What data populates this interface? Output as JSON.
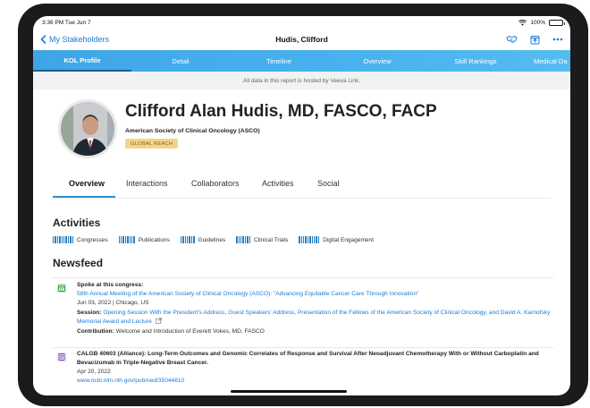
{
  "status": {
    "time_date": "3:36 PM   Tue Jun 7",
    "battery": "100%"
  },
  "nav": {
    "back_label": "My Stakeholders",
    "title": "Hudis, Clifford"
  },
  "tabs": [
    {
      "label": "KOL Profile",
      "active": true
    },
    {
      "label": "Detail"
    },
    {
      "label": "Timeline"
    },
    {
      "label": "Overview"
    },
    {
      "label": "Skill Rankings"
    },
    {
      "label": "Medical Da"
    }
  ],
  "hosted_note": "All data in this report is hosted by Veeva Link.",
  "profile": {
    "name": "Clifford Alan Hudis, MD, FASCO, FACP",
    "organization": "American Society of Clinical Oncology (ASCO)",
    "badge": "GLOBAL REACH"
  },
  "subtabs": [
    "Overview",
    "Interactions",
    "Collaborators",
    "Activities",
    "Social"
  ],
  "activities": {
    "title": "Activities",
    "legend": [
      "Congresses",
      "Publications",
      "Guidelines",
      "Clinical Trials",
      "Digital Engagement"
    ],
    "color": "#2a7fbf"
  },
  "newsfeed": {
    "title": "Newsfeed",
    "items": [
      {
        "icon": "calendar-icon",
        "heading": "Spoke at this congress:",
        "event_link": "58th Annual Meeting of the American Society of Clinical Oncology (ASCO): \"Advancing Equitable Cancer Care Through Innovation\"",
        "date_place": "Jun 03, 2022 | Chicago, US",
        "session_label": "Session:",
        "session_link": "Opening Session With the President's Address, Guest Speakers' Address, Presentation of the Fellows of the American Society of Clinical Oncology, and David A. Karnofsky Memorial Award and Lecture",
        "contribution_label": "Contribution:",
        "contribution_text": "Welcome and Introduction of Everett Vokes, MD, FASCO"
      },
      {
        "icon": "document-icon",
        "title": "CALGB 40603 (Alliance): Long-Term Outcomes and Genomic Correlates of Response and Survival After Neoadjuvant Chemotherapy With or Without Carboplatin and Bevacizumab in Triple-Negative Breast Cancer.",
        "date": "Apr 20, 2022",
        "url": "www.ncbi.nlm.nih.gov/pubmed/35044810"
      }
    ]
  },
  "colors": {
    "accent": "#1a7bd6",
    "tab_bar": "#49b2ee",
    "badge_bg": "#f2d58c"
  }
}
